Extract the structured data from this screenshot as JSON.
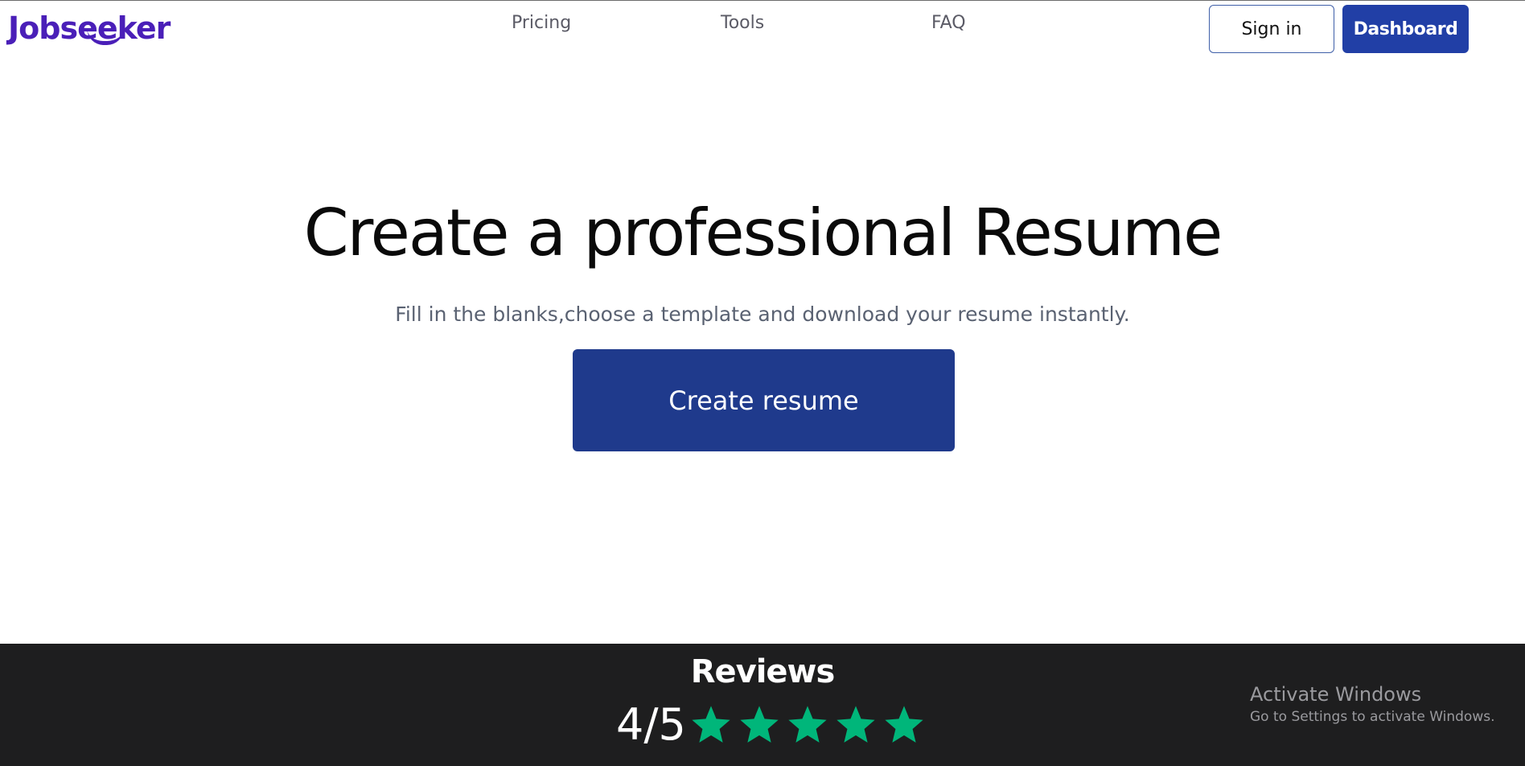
{
  "header": {
    "logo_text": "Jobseeker",
    "nav": [
      {
        "label": "Pricing"
      },
      {
        "label": "Tools"
      },
      {
        "label": "FAQ"
      }
    ],
    "signin_label": "Sign in",
    "dashboard_label": "Dashboard"
  },
  "hero": {
    "title": "Create a professional Resume",
    "subtitle": "Fill in the blanks,choose a template and download your resume instantly.",
    "cta_label": "Create resume"
  },
  "reviews": {
    "title": "Reviews",
    "rating_text": "4/5",
    "star_count": 5,
    "star_color": "#00b67a"
  },
  "watermark": {
    "title": "Activate Windows",
    "subtitle": "Go to Settings to activate Windows."
  },
  "colors": {
    "brand": "#4a1fb8",
    "primary_button": "#213fa6",
    "cta_button": "#1f3a8c",
    "footer_bg": "#1e1e1f"
  }
}
